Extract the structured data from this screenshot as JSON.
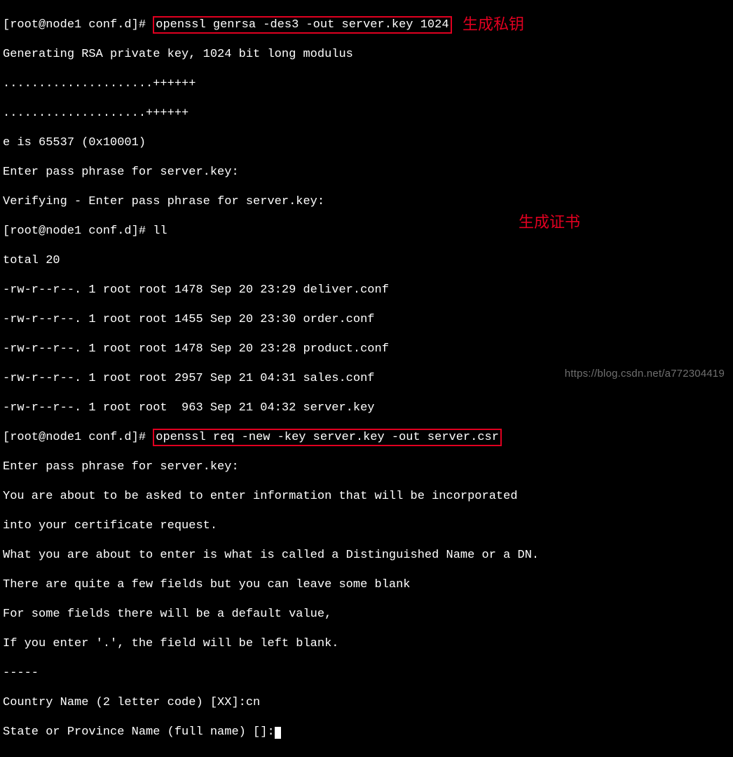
{
  "prompt1_prefix": "[root@node1 conf.d]# ",
  "cmd1": "openssl genrsa -des3 -out server.key 1024",
  "gen_line": "Generating RSA private key, 1024 bit long modulus",
  "dots1": ".....................++++++",
  "dots2": "....................++++++",
  "e_line": "e is 65537 (0x10001)",
  "pass1": "Enter pass phrase for server.key:",
  "pass2": "Verifying - Enter pass phrase for server.key:",
  "prompt2": "[root@node1 conf.d]# ll",
  "total": "total 20",
  "ls": [
    "-rw-r--r--. 1 root root 1478 Sep 20 23:29 deliver.conf",
    "-rw-r--r--. 1 root root 1455 Sep 20 23:30 order.conf",
    "-rw-r--r--. 1 root root 1478 Sep 20 23:28 product.conf",
    "-rw-r--r--. 1 root root 2957 Sep 21 04:31 sales.conf",
    "-rw-r--r--. 1 root root  963 Sep 21 04:32 server.key"
  ],
  "prompt3_prefix": "[root@node1 conf.d]# ",
  "cmd3": "openssl req -new -key server.key -out server.csr",
  "enter_pass": "Enter pass phrase for server.key:",
  "info1": "You are about to be asked to enter information that will be incorporated",
  "info2": "into your certificate request.",
  "info3": "What you are about to enter is what is called a Distinguished Name or a DN.",
  "info4": "There are quite a few fields but you can leave some blank",
  "info5": "For some fields there will be a default value,",
  "info6": "If you enter '.', the field will be left blank.",
  "dashes": "-----",
  "country": "Country Name (2 letter code) [XX]:cn",
  "state": "State or Province Name (full name) []:",
  "annotation1": "生成私钥",
  "annotation2": "生成证书",
  "watermark": "https://blog.csdn.net/a772304419"
}
